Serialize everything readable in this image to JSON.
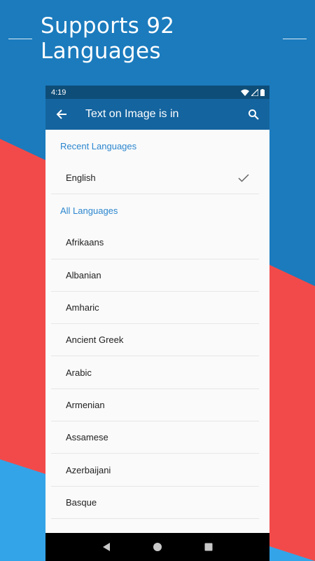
{
  "promo": {
    "title": "Supports 92 Languages"
  },
  "status_bar": {
    "time": "4:19"
  },
  "app_bar": {
    "title": "Text on Image is in"
  },
  "recent": {
    "header": "Recent Languages",
    "items": [
      {
        "label": "English",
        "selected": true
      }
    ]
  },
  "all": {
    "header": "All Languages",
    "items": [
      {
        "label": "Afrikaans"
      },
      {
        "label": "Albanian"
      },
      {
        "label": "Amharic"
      },
      {
        "label": "Ancient Greek"
      },
      {
        "label": "Arabic"
      },
      {
        "label": "Armenian"
      },
      {
        "label": "Assamese"
      },
      {
        "label": "Azerbaijani"
      },
      {
        "label": "Basque"
      }
    ]
  },
  "icons": {
    "back": "arrow-back-icon",
    "search": "search-icon",
    "check": "check-icon",
    "wifi": "wifi-icon",
    "signal": "signal-icon",
    "battery": "battery-icon",
    "nav_back": "nav-back-icon",
    "nav_home": "nav-home-icon",
    "nav_recents": "nav-recents-icon"
  },
  "colors": {
    "background_blue": "#1b7bbd",
    "background_red": "#f24a4a",
    "background_light_blue": "#34a4e8",
    "status_bar": "#0e4d78",
    "app_bar": "#14649f",
    "section_header": "#2b86cf"
  }
}
